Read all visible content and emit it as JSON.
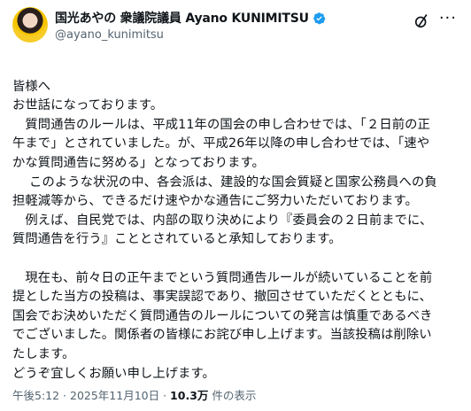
{
  "author": {
    "display_name": "国光あやの 衆議院議員 Ayano KUNIMITSU",
    "handle": "@ayano_kunimitsu"
  },
  "post": {
    "lines": [
      "皆様へ",
      "お世話になっております。",
      "　質問通告のルールは、平成11年の国会の申し合わせでは、「２日前の正",
      "午まで」とされていました。が、平成26年以降の申し合わせでは、「速や",
      "かな質問通告に努める」となっております。",
      "　 このような状況の中、各会派は、建設的な国会質疑と国家公務員への負",
      "担軽減等から、できるだけ速やかな通告にご努力いただいております。",
      "　例えば、自民党では、内部の取り決めにより『委員会の２日前までに、",
      "質問通告を行う』こととされていると承知しております。",
      "",
      "　現在も、前々日の正午までという質問通告ルールが続いていることを前",
      "提とした当方の投稿は、事実誤認であり、撤回させていただくとともに、",
      "国会でお決めいただく質問通告のルールについての発言は慎重であるべき",
      "でございました。関係者の皆様にお詫び申し上げます。当該投稿は削除い",
      "たします。",
      "どうぞ宜しくお願い申し上げます。"
    ]
  },
  "meta": {
    "time": "午後5:12",
    "separator1": " · ",
    "date": "2025年11月10日",
    "separator2": " · ",
    "views": "10.3万",
    "views_label": " 件の表示"
  },
  "colors": {
    "verified_badge": "#1d9bf0",
    "muted_text": "#536471"
  }
}
